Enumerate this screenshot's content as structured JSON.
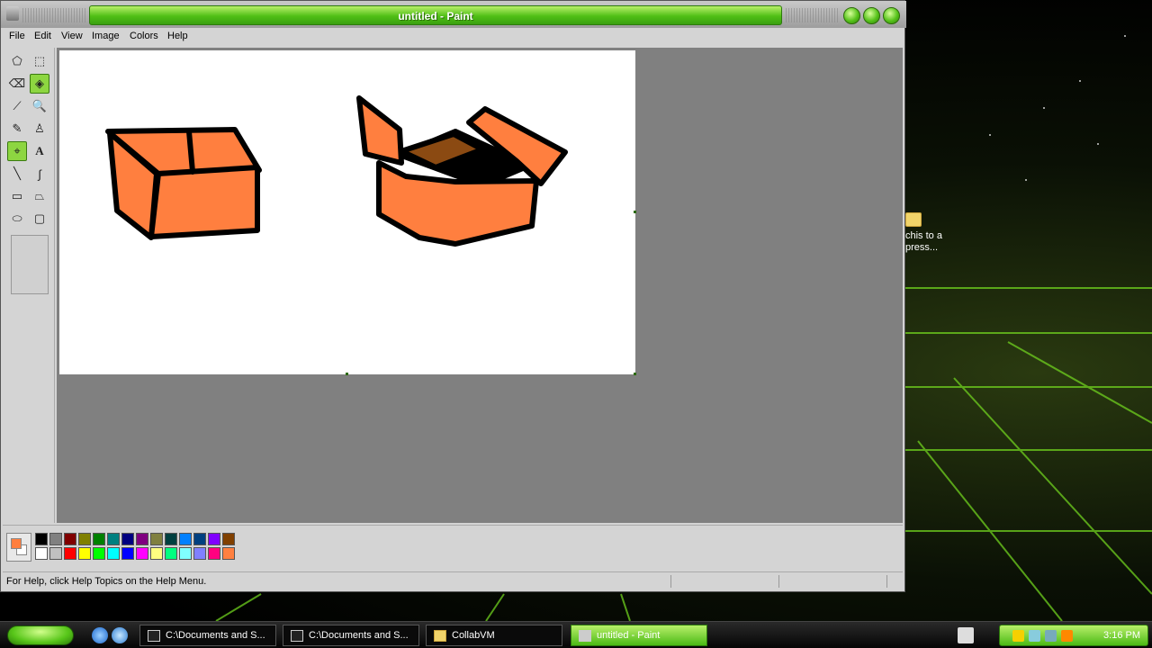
{
  "window": {
    "title": "untitled - Paint"
  },
  "menu": [
    "File",
    "Edit",
    "View",
    "Image",
    "Colors",
    "Help"
  ],
  "tools": [
    {
      "name": "free-form-select",
      "glyph": "⬠"
    },
    {
      "name": "select",
      "glyph": "⬚"
    },
    {
      "name": "eraser",
      "glyph": "⌫"
    },
    {
      "name": "fill-with-color",
      "glyph": "◈"
    },
    {
      "name": "pick-color",
      "glyph": "⟋"
    },
    {
      "name": "magnifier",
      "glyph": "🔍"
    },
    {
      "name": "pencil",
      "glyph": "✎"
    },
    {
      "name": "brush",
      "glyph": "♙"
    },
    {
      "name": "airbrush",
      "glyph": "⌖"
    },
    {
      "name": "text",
      "glyph": "A"
    },
    {
      "name": "line",
      "glyph": "╲"
    },
    {
      "name": "curve",
      "glyph": "∫"
    },
    {
      "name": "rectangle",
      "glyph": "▭"
    },
    {
      "name": "polygon",
      "glyph": "⏢"
    },
    {
      "name": "ellipse",
      "glyph": "⬭"
    },
    {
      "name": "rounded-rectangle",
      "glyph": "▢"
    }
  ],
  "colors": {
    "foreground": "#ff7f3f",
    "background": "#ffffff",
    "palette_top": [
      "#000000",
      "#808080",
      "#800000",
      "#808000",
      "#008000",
      "#008080",
      "#000080",
      "#800080",
      "#808040",
      "#004040",
      "#0080ff",
      "#004080",
      "#8000ff",
      "#804000"
    ],
    "palette_bottom": [
      "#ffffff",
      "#c0c0c0",
      "#ff0000",
      "#ffff00",
      "#00ff00",
      "#00ffff",
      "#0000ff",
      "#ff00ff",
      "#ffff80",
      "#00ff80",
      "#80ffff",
      "#8080ff",
      "#ff0080",
      "#ff8040"
    ]
  },
  "status": {
    "help_text": "For Help, click Help Topics on the Help Menu."
  },
  "desktop": {
    "icon_label_line1": "chis to a",
    "icon_label_line2": "press..."
  },
  "taskbar": {
    "tasks": [
      {
        "label": "C:\\Documents and S..."
      },
      {
        "label": "C:\\Documents and S..."
      },
      {
        "label": "CollabVM"
      },
      {
        "label": "untitled - Paint"
      }
    ],
    "clock": "3:16 PM"
  }
}
